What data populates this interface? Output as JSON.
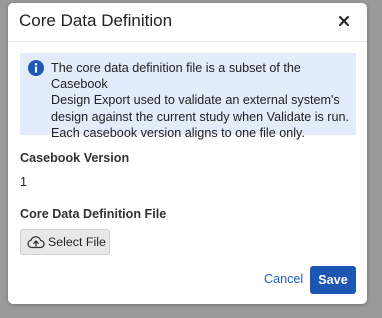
{
  "dialog": {
    "title": "Core Data Definition",
    "close_icon": "close-icon"
  },
  "info": {
    "icon": "info-icon",
    "lines": [
      "The core data definition file is a subset of the Casebook",
      "Design Export used to validate an external system's",
      "design against the current study when Validate is run.",
      "Each casebook version aligns to one file only."
    ]
  },
  "casebook_version": {
    "label": "Casebook Version",
    "value": "1"
  },
  "core_file": {
    "label": "Core Data Definition File",
    "button_label": "Select File",
    "button_icon": "cloud-upload-icon"
  },
  "footer": {
    "cancel_label": "Cancel",
    "save_label": "Save"
  },
  "colors": {
    "info_background": "#e3ecfb",
    "info_icon": "#1d57b3",
    "primary": "#1d57b3",
    "link": "#1f5fbf",
    "overlay": "#9a9a9a"
  }
}
